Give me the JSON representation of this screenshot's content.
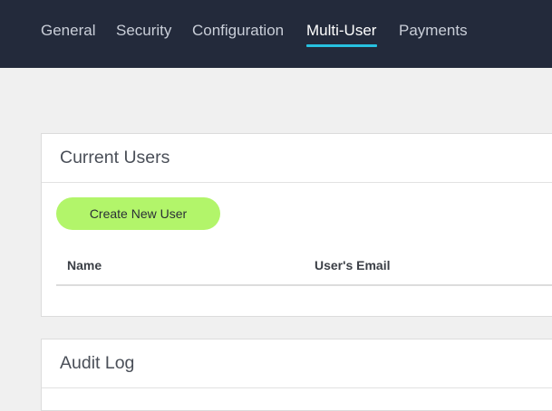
{
  "nav": {
    "tabs": [
      {
        "label": "General",
        "active": false
      },
      {
        "label": "Security",
        "active": false
      },
      {
        "label": "Configuration",
        "active": false
      },
      {
        "label": "Multi-User",
        "active": true
      },
      {
        "label": "Payments",
        "active": false
      }
    ]
  },
  "current_users": {
    "title": "Current Users",
    "create_button_label": "Create New User",
    "columns": [
      "Name",
      "User's Email"
    ],
    "rows": []
  },
  "audit_log": {
    "title": "Audit Log"
  },
  "colors": {
    "nav_bg": "#232a3b",
    "active_underline": "#27c1e0",
    "create_button": "#b2f56a"
  }
}
